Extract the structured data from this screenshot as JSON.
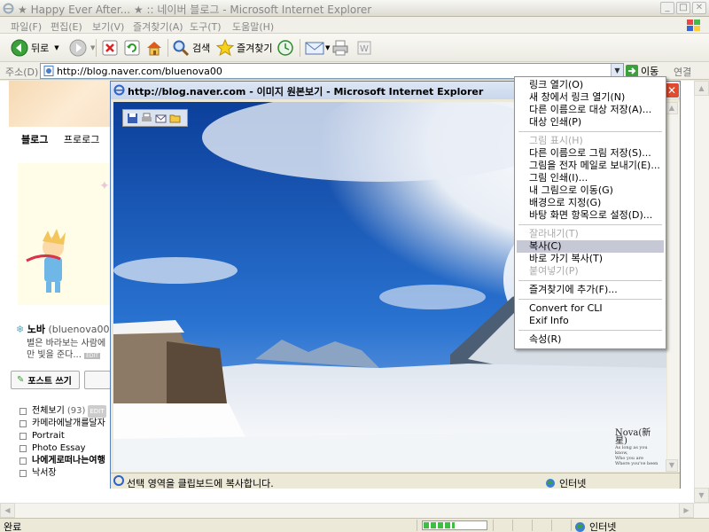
{
  "window": {
    "title": "★ Happy Ever After... ★ :: 네이버 블로그 - Microsoft Internet Explorer"
  },
  "menubar": {
    "items": [
      "파일(F)",
      "편집(E)",
      "보기(V)",
      "즐겨찾기(A)",
      "도구(T)",
      "도움말(H)"
    ]
  },
  "toolbar": {
    "back_label": "뒤로",
    "search_label": "검색",
    "favorites_label": "즐겨찾기"
  },
  "address": {
    "label": "주소(D)",
    "url": "http://blog.naver.com/bluenova00",
    "go_label": "이동",
    "links_label": "연결"
  },
  "blog": {
    "tabs": [
      "블로그",
      "프로로그"
    ],
    "profile_name": "노바",
    "profile_id": "(bluenova00)",
    "profile_desc": "별은 바라보는 사람에 만 빛을 준다...",
    "edit_badge": "EDIT",
    "post_button": "포스트 쓰기",
    "categories": [
      {
        "label": "전체보기",
        "count": "(93)",
        "edit": "EDIT",
        "bold": false
      },
      {
        "label": "카메라에날개를달자",
        "count": "",
        "edit": "",
        "bold": false
      },
      {
        "label": "Portrait",
        "count": "",
        "edit": "",
        "bold": false
      },
      {
        "label": "Photo Essay",
        "count": "",
        "edit": "",
        "bold": false
      },
      {
        "label": "나에게로떠나는여행",
        "count": "",
        "edit": "",
        "bold": true
      },
      {
        "label": "낙서장",
        "count": "",
        "edit": "",
        "bold": false
      }
    ]
  },
  "popup": {
    "title": "http://blog.naver.com - 이미지 원본보기 - Microsoft Internet Explorer",
    "status_text": "선택 영역을 클립보드에 복사합니다.",
    "zone_label": "인터넷",
    "signature": {
      "text": "Nova(新星)",
      "lines": [
        "As long as you know,",
        "Who you are",
        "Where you've been"
      ]
    }
  },
  "context_menu": {
    "items": [
      {
        "label": "링크 열기(O)",
        "disabled": false,
        "selected": false
      },
      {
        "label": "새 창에서 링크 열기(N)",
        "disabled": false,
        "selected": false
      },
      {
        "label": "다른 이름으로 대상 저장(A)...",
        "disabled": false,
        "selected": false
      },
      {
        "label": "대상 인쇄(P)",
        "disabled": false,
        "selected": false
      },
      {
        "sep": true
      },
      {
        "label": "그림 표시(H)",
        "disabled": true,
        "selected": false
      },
      {
        "label": "다른 이름으로 그림 저장(S)...",
        "disabled": false,
        "selected": false
      },
      {
        "label": "그림을 전자 메일로 보내기(E)...",
        "disabled": false,
        "selected": false
      },
      {
        "label": "그림 인쇄(I)...",
        "disabled": false,
        "selected": false
      },
      {
        "label": "내 그림으로 이동(G)",
        "disabled": false,
        "selected": false
      },
      {
        "label": "배경으로 지정(G)",
        "disabled": false,
        "selected": false
      },
      {
        "label": "바탕 화면 항목으로 설정(D)...",
        "disabled": false,
        "selected": false
      },
      {
        "sep": true
      },
      {
        "label": "잘라내기(T)",
        "disabled": true,
        "selected": false
      },
      {
        "label": "복사(C)",
        "disabled": false,
        "selected": true
      },
      {
        "label": "바로 가기 복사(T)",
        "disabled": false,
        "selected": false
      },
      {
        "label": "붙여넣기(P)",
        "disabled": true,
        "selected": false
      },
      {
        "sep": true
      },
      {
        "label": "즐겨찾기에 추가(F)...",
        "disabled": false,
        "selected": false
      },
      {
        "sep": true
      },
      {
        "label": "Convert for CLI",
        "disabled": false,
        "selected": false
      },
      {
        "label": "Exif Info",
        "disabled": false,
        "selected": false
      },
      {
        "sep": true
      },
      {
        "label": "속성(R)",
        "disabled": false,
        "selected": false
      }
    ]
  },
  "statusbar": {
    "text": "완료",
    "zone_label": "인터넷",
    "progress_percent": 100
  },
  "colors": {
    "title_active": "#c9d6ec",
    "menu_selected": "#c6c8d6",
    "close_red": "#e24a2d",
    "sky_blue": "#1a58b4"
  }
}
